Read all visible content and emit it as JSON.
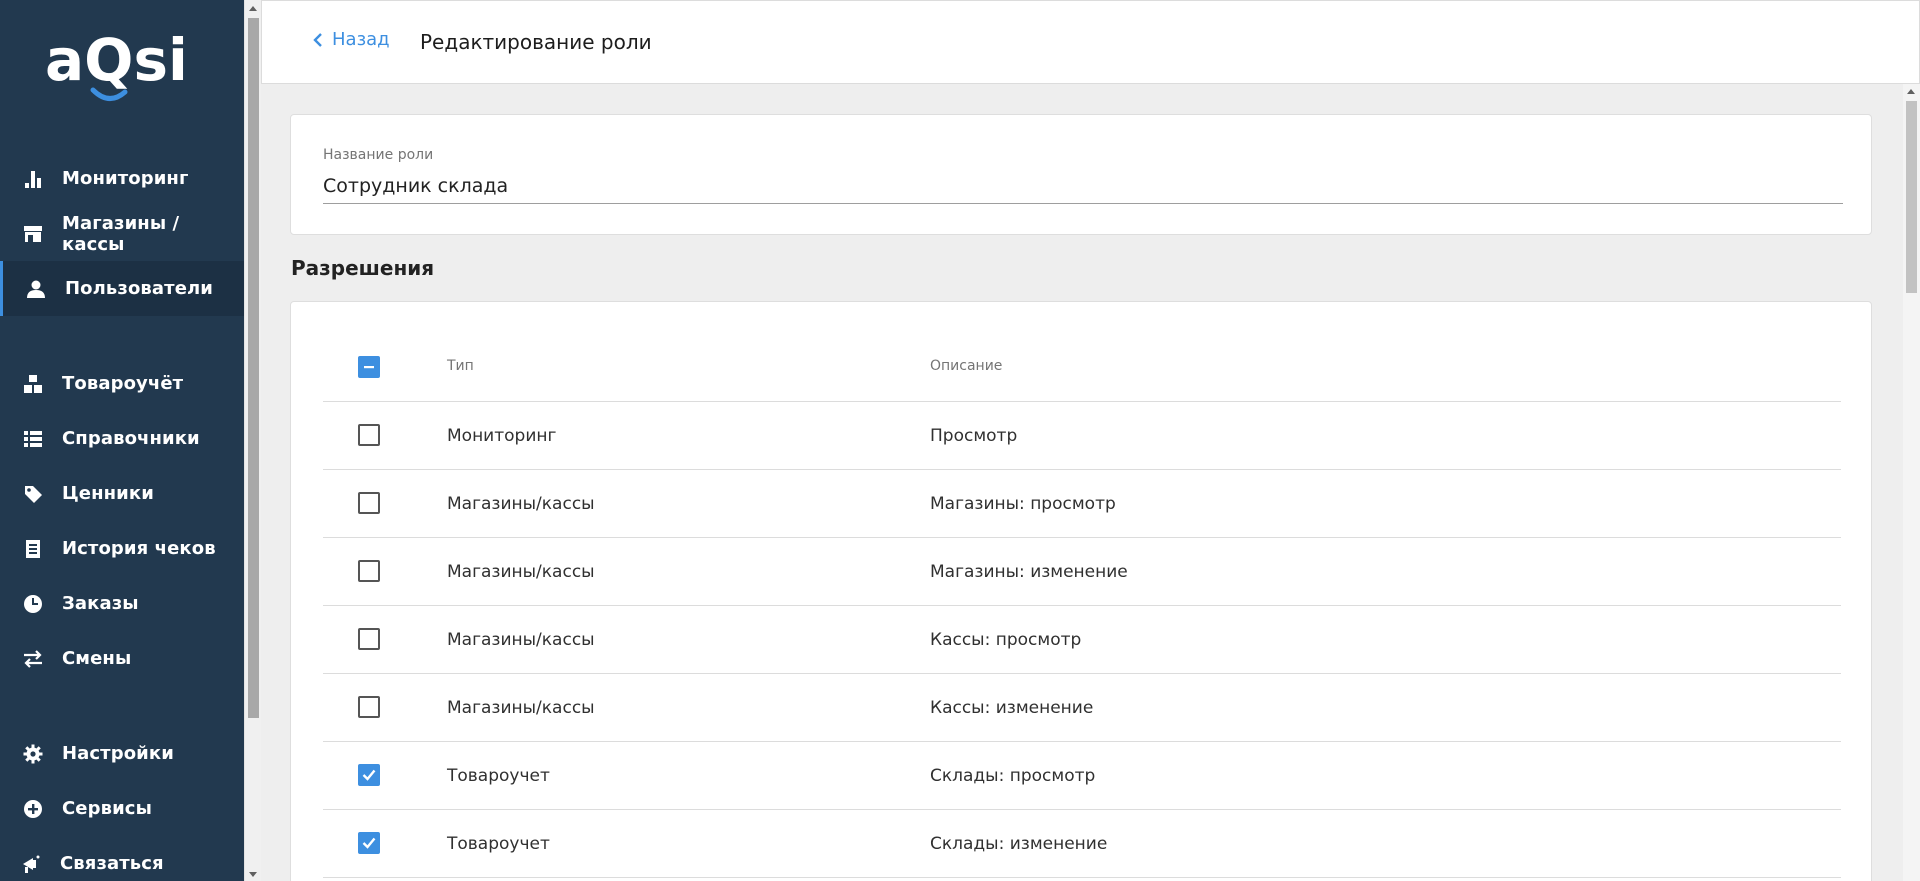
{
  "logo_text": "aQsi",
  "sidebar": {
    "items": [
      {
        "label": "Мониторинг",
        "icon": "bar-chart-icon"
      },
      {
        "label": "Магазины / кассы",
        "icon": "store-icon"
      },
      {
        "label": "Пользователи",
        "icon": "user-icon",
        "active": true
      },
      {
        "label": "Товароучёт",
        "icon": "boxes-icon"
      },
      {
        "label": "Справочники",
        "icon": "list-icon"
      },
      {
        "label": "Ценники",
        "icon": "tag-icon"
      },
      {
        "label": "История чеков",
        "icon": "receipt-icon"
      },
      {
        "label": "Заказы",
        "icon": "clock-icon"
      },
      {
        "label": "Смены",
        "icon": "swap-icon"
      },
      {
        "label": "Настройки",
        "icon": "gear-icon"
      },
      {
        "label": "Сервисы",
        "icon": "plus-circle-icon"
      },
      {
        "label": "Связаться",
        "icon": "megaphone-icon"
      }
    ]
  },
  "header": {
    "back_label": "Назад",
    "title": "Редактирование роли"
  },
  "role_form": {
    "label": "Название роли",
    "value": "Сотрудник склада"
  },
  "permissions": {
    "title": "Разрешения",
    "columns": {
      "type": "Тип",
      "description": "Описание"
    },
    "header_checkbox": "indeterminate",
    "rows": [
      {
        "type": "Мониторинг",
        "description": "Просмотр",
        "checked": false
      },
      {
        "type": "Магазины/кассы",
        "description": "Магазины: просмотр",
        "checked": false
      },
      {
        "type": "Магазины/кассы",
        "description": "Магазины: изменение",
        "checked": false
      },
      {
        "type": "Магазины/кассы",
        "description": "Кассы: просмотр",
        "checked": false
      },
      {
        "type": "Магазины/кассы",
        "description": "Кассы: изменение",
        "checked": false
      },
      {
        "type": "Товароучет",
        "description": "Склады: просмотр",
        "checked": true
      },
      {
        "type": "Товароучет",
        "description": "Склады: изменение",
        "checked": true
      }
    ]
  },
  "colors": {
    "sidebar_bg": "#22394f",
    "accent": "#3d8fe0",
    "page_bg": "#eeeeee"
  }
}
